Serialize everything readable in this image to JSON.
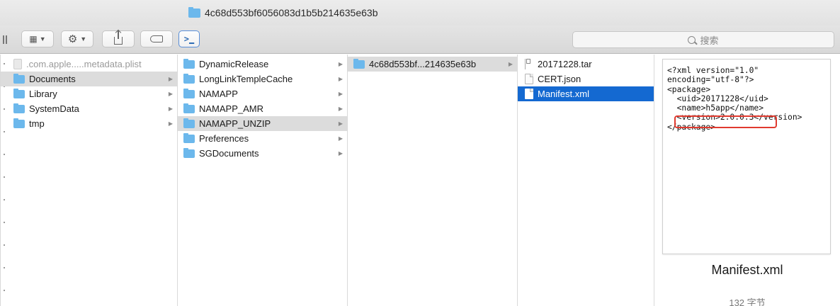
{
  "window": {
    "title": "4c68d553bf6056083d1b5b214635e63b"
  },
  "toolbar": {
    "search_placeholder": "搜索"
  },
  "columns": {
    "col1": [
      {
        "label": ".com.apple.....metadata.plist",
        "kind": "plist"
      },
      {
        "label": "Documents",
        "kind": "folder"
      },
      {
        "label": "Library",
        "kind": "folder"
      },
      {
        "label": "SystemData",
        "kind": "folder"
      },
      {
        "label": "tmp",
        "kind": "folder"
      }
    ],
    "col2": [
      {
        "label": "DynamicRelease",
        "kind": "folder"
      },
      {
        "label": "LongLinkTempleCache",
        "kind": "folder"
      },
      {
        "label": "NAMAPP",
        "kind": "folder"
      },
      {
        "label": "NAMAPP_AMR",
        "kind": "folder"
      },
      {
        "label": "NAMAPP_UNZIP",
        "kind": "folder"
      },
      {
        "label": "Preferences",
        "kind": "folder"
      },
      {
        "label": "SGDocuments",
        "kind": "folder"
      }
    ],
    "col3": [
      {
        "label": "4c68d553bf...214635e63b",
        "kind": "folder"
      }
    ],
    "col4": [
      {
        "label": "20171228.tar",
        "kind": "tar"
      },
      {
        "label": "CERT.json",
        "kind": "file"
      },
      {
        "label": "Manifest.xml",
        "kind": "file"
      }
    ]
  },
  "preview": {
    "lines": [
      "<?xml version=\"1.0\"",
      "encoding=\"utf-8\"?>",
      "<package>",
      "  <uid>20171228</uid>",
      "  <name>h5app</name>",
      "  <version>2.0.0.3</version>",
      "</package>"
    ],
    "filename": "Manifest.xml",
    "size": "132 字节"
  },
  "colors": {
    "selection": "#1469d1",
    "folder": "#6cb8ec",
    "annotation": "#e03a2f"
  }
}
